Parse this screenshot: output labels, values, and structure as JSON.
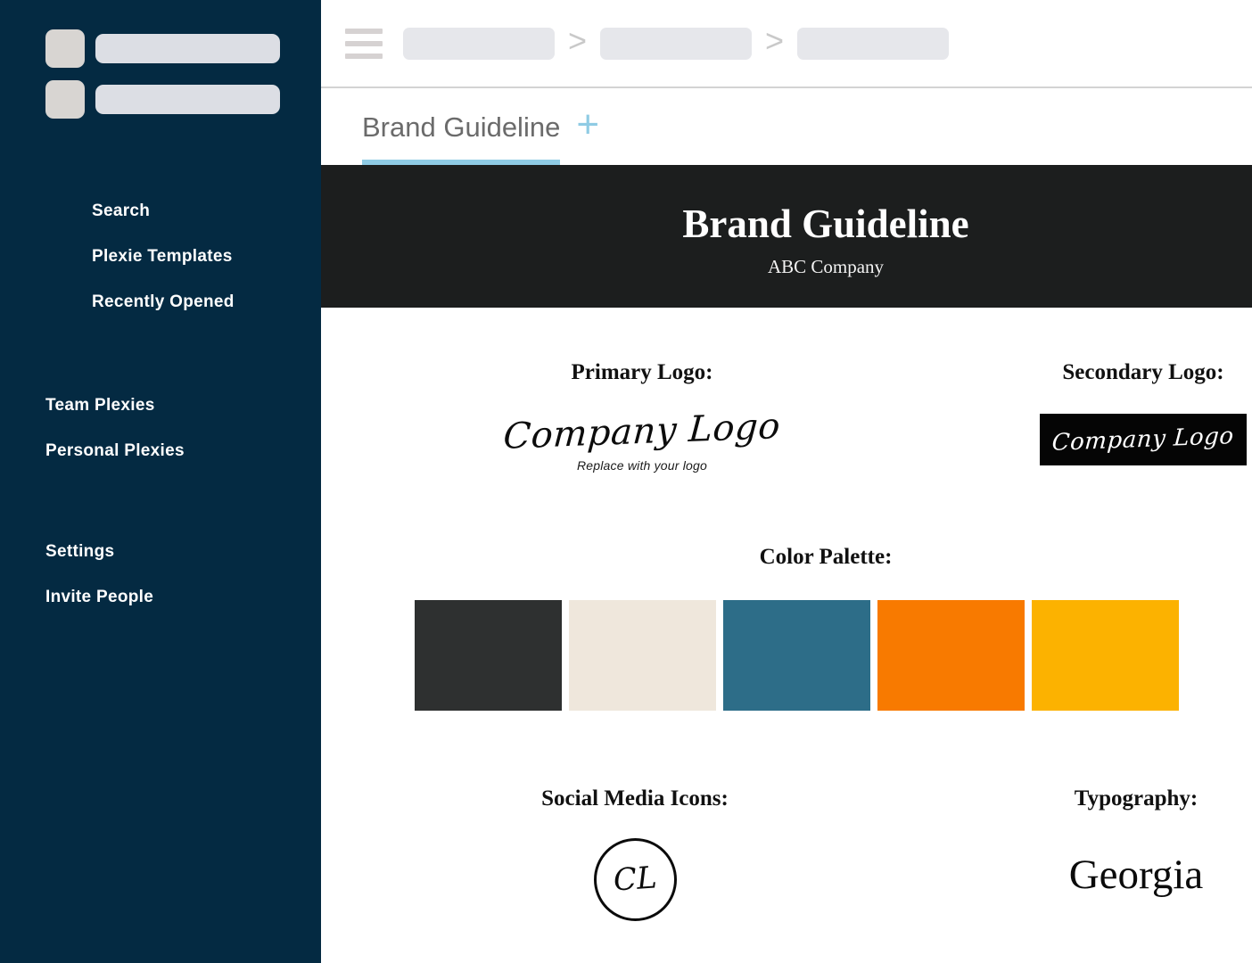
{
  "sidebar": {
    "placeholder_rows": [
      {
        "name": "avatar-placeholder-1",
        "bar": "name-placeholder-1"
      },
      {
        "name": "avatar-placeholder-2",
        "bar": "name-placeholder-2"
      }
    ],
    "groups": [
      {
        "id": "nav-primary",
        "items": [
          {
            "label": "Search"
          },
          {
            "label": "Plexie Templates"
          },
          {
            "label": "Recently Opened"
          }
        ]
      },
      {
        "id": "nav-plexies",
        "items": [
          {
            "label": "Team Plexies"
          },
          {
            "label": "Personal Plexies"
          }
        ]
      },
      {
        "id": "nav-account",
        "items": [
          {
            "label": "Settings"
          },
          {
            "label": "Invite People"
          }
        ]
      }
    ],
    "background_color": "#042a42"
  },
  "topbar": {
    "menu_icon": "hamburger-menu-icon",
    "breadcrumb": {
      "separator": ">",
      "crumbs": [
        "",
        "",
        ""
      ]
    }
  },
  "tabs": {
    "items": [
      {
        "label": "Brand Guideline",
        "active": true
      }
    ],
    "add_tab_label": "+",
    "active_underline_color": "#8fcbe4"
  },
  "document": {
    "banner": {
      "title": "Brand Guideline",
      "subtitle": "ABC Company",
      "background_color": "#1c1e1e"
    },
    "primary_logo": {
      "heading": "Primary Logo:",
      "logo_text": "Company Logo",
      "caption": "Replace with your logo"
    },
    "secondary_logo": {
      "heading": "Secondary Logo:",
      "logo_text": "Company Logo",
      "background_color": "#050505"
    },
    "color_palette": {
      "heading": "Color Palette:",
      "swatches": [
        {
          "name": "swatch-charcoal",
          "color": "#2e3030"
        },
        {
          "name": "swatch-cream",
          "color": "#efe7dc"
        },
        {
          "name": "swatch-teal-blue",
          "color": "#2d6d88"
        },
        {
          "name": "swatch-orange",
          "color": "#f87a00"
        },
        {
          "name": "swatch-amber",
          "color": "#fcb200"
        }
      ]
    },
    "social_media": {
      "heading": "Social Media Icons:",
      "monogram": "CL"
    },
    "typography": {
      "heading": "Typography:",
      "sample": "Georgia"
    }
  }
}
